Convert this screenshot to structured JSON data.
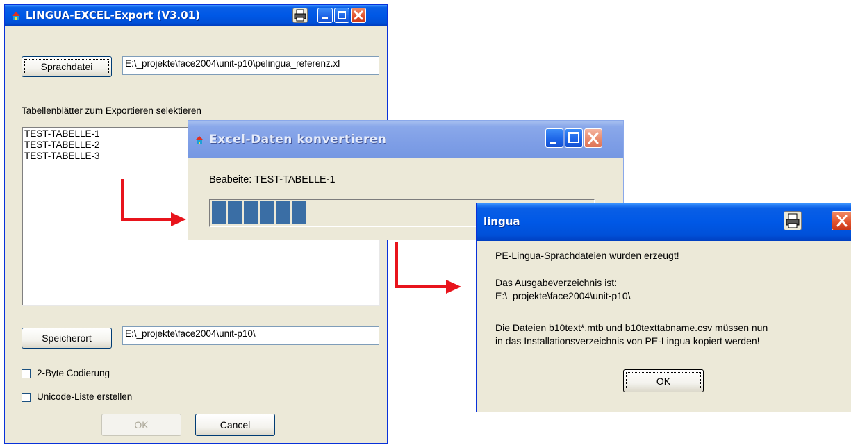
{
  "main_window": {
    "title": "LINGUA-EXCEL-Export (V3.01)",
    "language_file_button": "Sprachdatei",
    "language_file_path": "E:\\_projekte\\face2004\\unit-p10\\pelingua_referenz.xl",
    "sheets_label": "Tabellenblätter zum Exportieren selektieren",
    "sheets": [
      "TEST-TABELLE-1",
      "TEST-TABELLE-2",
      "TEST-TABELLE-3"
    ],
    "save_location_button": "Speicherort",
    "save_location_path": "E:\\_projekte\\face2004\\unit-p10\\",
    "checkbox_2byte": "2-Byte Codierung",
    "checkbox_unicode": "Unicode-Liste erstellen",
    "ok_button": "OK",
    "cancel_button": "Cancel"
  },
  "convert_window": {
    "title": "Excel-Daten konvertieren",
    "status": "Beabeite: TEST-TABELLE-1",
    "progress_blocks": 6
  },
  "message_box": {
    "title": "lingua",
    "line1": "PE-Lingua-Sprachdateien wurden erzeugt!",
    "line2": "Das Ausgabeverzeichnis ist:",
    "line3": "E:\\_projekte\\face2004\\unit-p10\\",
    "line4": "Die Dateien b10text*.mtb und b10texttabname.csv müssen nun",
    "line5": "in das Installationsverzeichnis von PE-Lingua kopiert werden!",
    "ok_button": "OK"
  },
  "colors": {
    "arrow": "#e8141c",
    "titlebar": "#0058e6",
    "progress": "#3a6ea5"
  },
  "icons": [
    "app-icon",
    "printer-icon",
    "minimize-icon",
    "maximize-icon",
    "close-icon",
    "arrow-icon"
  ]
}
